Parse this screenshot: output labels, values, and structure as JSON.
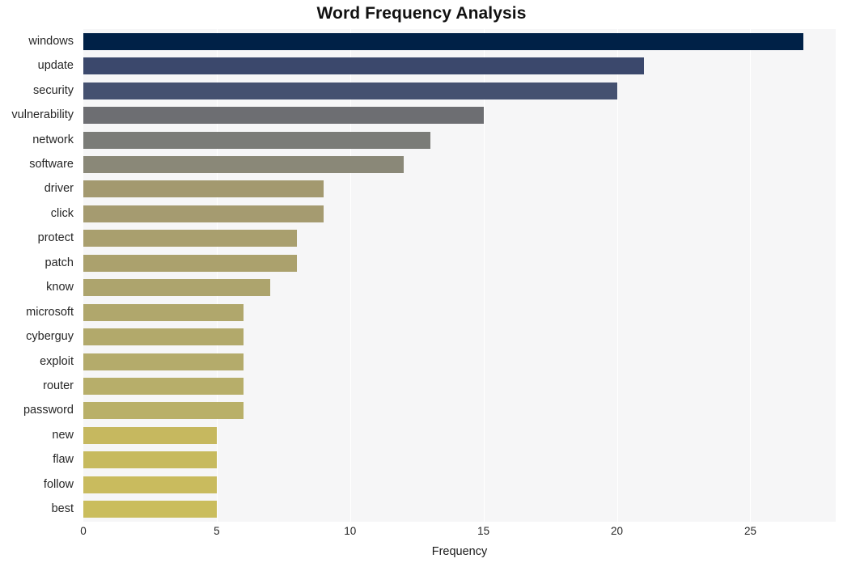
{
  "chart_data": {
    "type": "bar",
    "orientation": "horizontal",
    "title": "Word Frequency Analysis",
    "xlabel": "Frequency",
    "ylabel": "",
    "xlim": [
      0,
      28.2
    ],
    "ylim": [
      0,
      20
    ],
    "grid": true,
    "legend": false,
    "xticks": [
      0,
      5,
      10,
      15,
      20,
      25
    ],
    "xtick_labels": [
      "0",
      "5",
      "10",
      "15",
      "20",
      "25"
    ],
    "categories": [
      "windows",
      "update",
      "security",
      "vulnerability",
      "network",
      "software",
      "driver",
      "click",
      "protect",
      "patch",
      "know",
      "microsoft",
      "cyberguy",
      "exploit",
      "router",
      "password",
      "new",
      "flaw",
      "follow",
      "best"
    ],
    "values": [
      27,
      21,
      20,
      15,
      13,
      12,
      9,
      9,
      8,
      8,
      7,
      6,
      6,
      6,
      6,
      6,
      5,
      5,
      5,
      5
    ],
    "bar_colors": [
      "#002147",
      "#3b486c",
      "#455170",
      "#6d6e72",
      "#7b7c78",
      "#8a8878",
      "#a3996f",
      "#a59b70",
      "#a99f6e",
      "#aba16d",
      "#ada46d",
      "#b0a76c",
      "#b2a96b",
      "#b4ab6b",
      "#b7ae6a",
      "#b9b069",
      "#c6b85f",
      "#c7ba5e",
      "#c9bb5e",
      "#cabd5d"
    ],
    "plot_background": "#f6f6f7",
    "page_background": "#ffffff",
    "gridline_color": "#ffffff",
    "text_color": "#262626"
  }
}
